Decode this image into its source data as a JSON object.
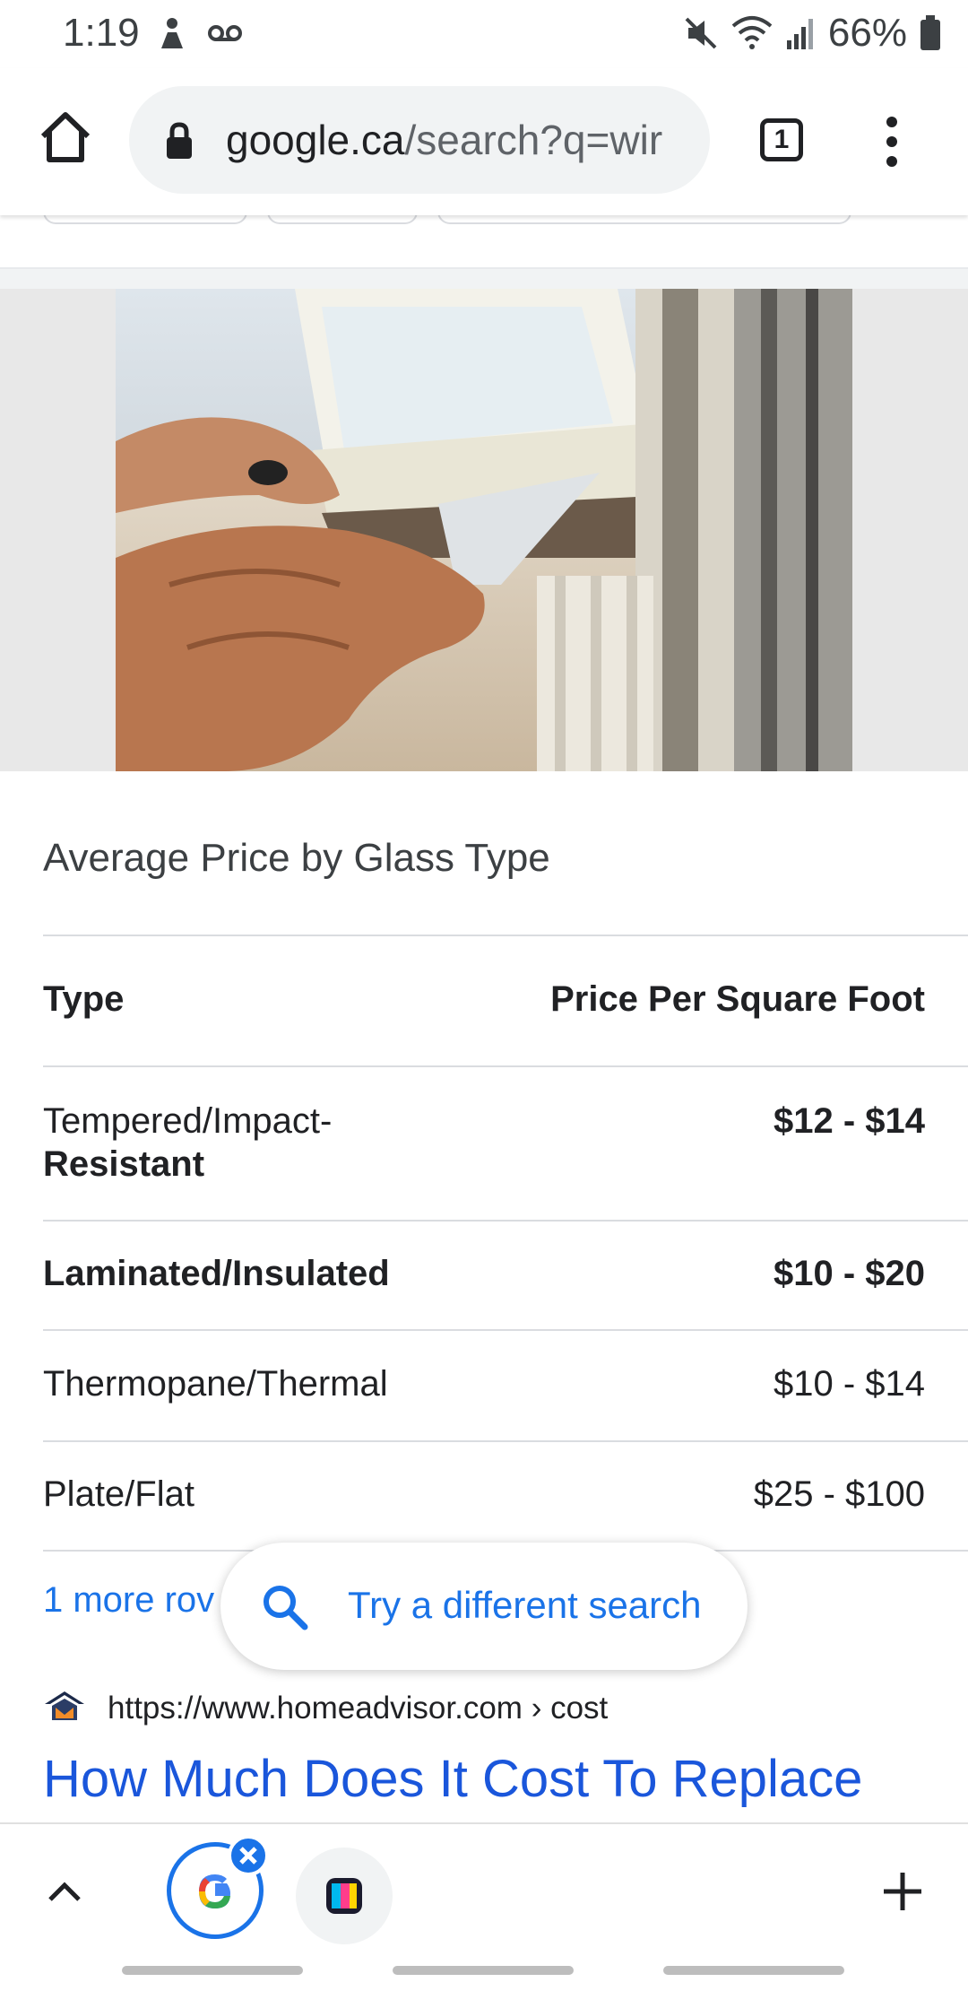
{
  "status_bar": {
    "time": "1:19",
    "battery": "66%"
  },
  "browser": {
    "url_host": "google.ca",
    "url_path": "/search?q=wir",
    "tab_count": "1"
  },
  "table": {
    "title": "Average Price by Glass Type",
    "headers": {
      "type": "Type",
      "price": "Price Per Square Foot"
    },
    "rows": [
      {
        "type_line1": "Tempered/Impact-",
        "type_line2": "Resistant",
        "price": "$12 - $14"
      },
      {
        "type": "Laminated/Insulated",
        "price": "$10 - $20"
      },
      {
        "type": "Thermopane/Thermal",
        "price": "$10 - $14"
      },
      {
        "type": "Plate/Flat",
        "price": "$25 - $100"
      }
    ],
    "more_rows": "1 more rov"
  },
  "floating_search": {
    "label": "Try a different search"
  },
  "next_result": {
    "url": "https://www.homeadvisor.com › cost",
    "title": "How Much Does It Cost To Replace"
  },
  "icons": {
    "status": [
      "person-icon",
      "voicemail-icon",
      "mute-icon",
      "wifi-icon",
      "signal-icon",
      "battery-icon"
    ],
    "toolbar": [
      "home-icon",
      "lock-icon",
      "tab-switcher-icon",
      "more-vert-icon"
    ],
    "bottom": [
      "chevron-up-icon",
      "google-tab-icon",
      "close-icon",
      "app-tab-icon",
      "plus-icon"
    ]
  },
  "colors": {
    "link": "#1a73e8",
    "result_title": "#1a56db",
    "text": "#202124"
  }
}
